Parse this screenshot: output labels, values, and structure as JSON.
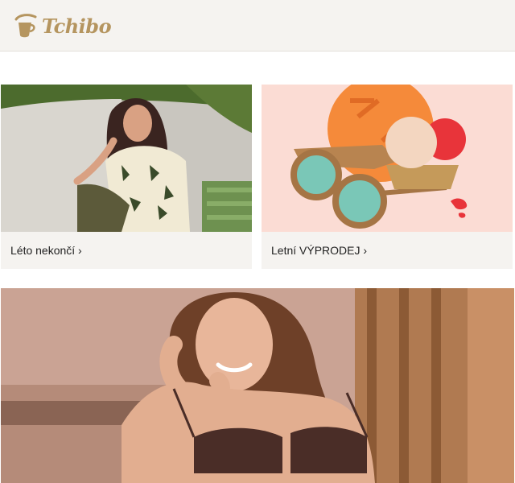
{
  "header": {
    "logo_text": "Tchibo",
    "logo_icon": "tchibo-cup-icon",
    "brand_color": "#b5955f"
  },
  "tiles": [
    {
      "caption": "Léto nekončí ›",
      "image": "woman-in-floral-shirt-photo"
    },
    {
      "caption": "Letní VÝPRODEJ ›",
      "image": "sunglasses-and-ice-cream-illustration"
    }
  ],
  "hero": {
    "image": "smiling-woman-in-brown-lingerie-photo"
  }
}
